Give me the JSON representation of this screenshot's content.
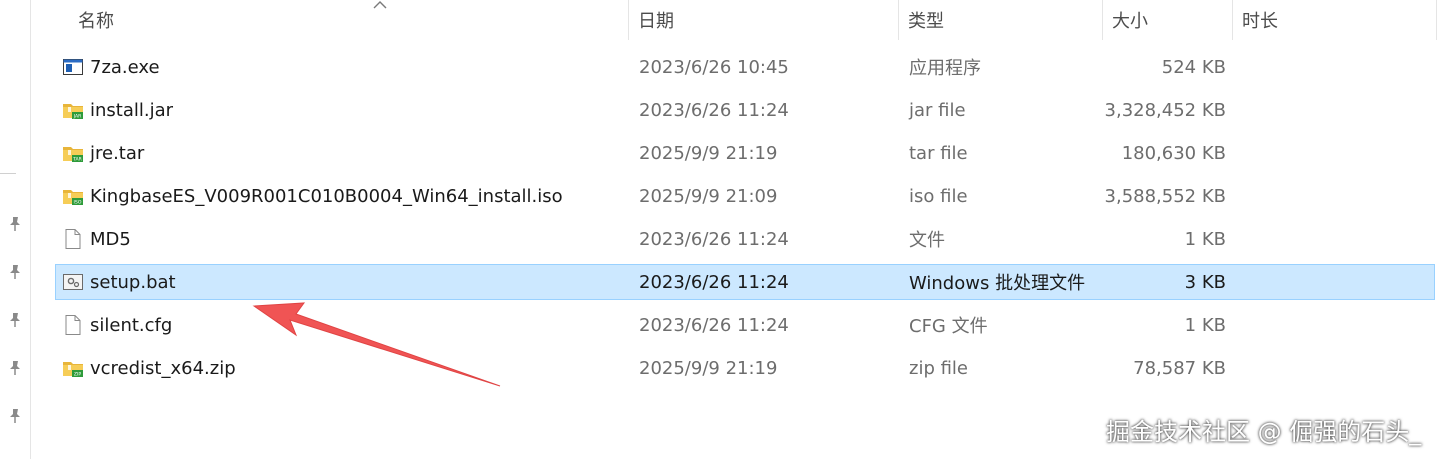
{
  "header": {
    "name": "名称",
    "date": "日期",
    "type": "类型",
    "size": "大小",
    "duration": "时长"
  },
  "files": [
    {
      "name": "7za.exe",
      "date": "2023/6/26 10:45",
      "type": "应用程序",
      "size": "524 KB",
      "icon": "exe-icon",
      "badge": ""
    },
    {
      "name": "install.jar",
      "date": "2023/6/26 11:24",
      "type": "jar file",
      "size": "3,328,452 KB",
      "icon": "archive-icon",
      "badge": "JAR"
    },
    {
      "name": "jre.tar",
      "date": "2025/9/9 21:19",
      "type": "tar file",
      "size": "180,630 KB",
      "icon": "archive-icon",
      "badge": "TAR"
    },
    {
      "name": "KingbaseES_V009R001C010B0004_Win64_install.iso",
      "date": "2025/9/9 21:09",
      "type": "iso file",
      "size": "3,588,552 KB",
      "icon": "archive-icon",
      "badge": "ISO"
    },
    {
      "name": "MD5",
      "date": "2023/6/26 11:24",
      "type": "文件",
      "size": "1 KB",
      "icon": "blank-file-icon",
      "badge": ""
    },
    {
      "name": "setup.bat",
      "date": "2023/6/26 11:24",
      "type": "Windows 批处理文件",
      "size": "3 KB",
      "icon": "batch-file-icon",
      "badge": "",
      "selected": true
    },
    {
      "name": "silent.cfg",
      "date": "2023/6/26 11:24",
      "type": "CFG 文件",
      "size": "1 KB",
      "icon": "blank-file-icon",
      "badge": ""
    },
    {
      "name": "vcredist_x64.zip",
      "date": "2025/9/9 21:19",
      "type": "zip file",
      "size": "78,587 KB",
      "icon": "archive-icon",
      "badge": "ZIP"
    }
  ],
  "watermark": "掘金技术社区 @ 倔强的石头_",
  "colors": {
    "selection_bg": "#cce8ff",
    "selection_border": "#99d1ff",
    "folder_yellow": "#f3c243",
    "badge_green": "#2e9b3a",
    "arrow_red": "#f05454"
  }
}
